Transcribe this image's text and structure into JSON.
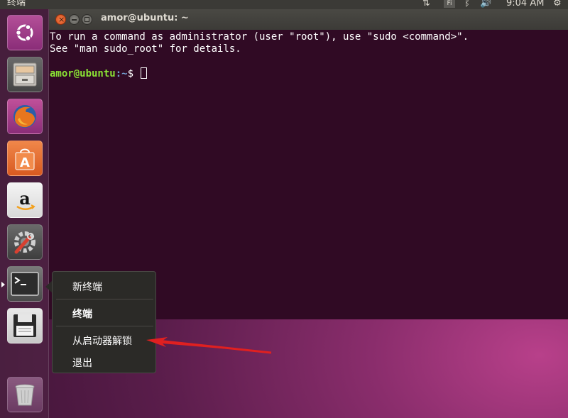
{
  "top_panel": {
    "app_title": "终端",
    "input_method": "Fi",
    "clock": "9:04 AM"
  },
  "terminal": {
    "title": "amor@ubuntu: ~",
    "output_line1": "To run a command as administrator (user \"root\"), use \"sudo <command>\".",
    "output_line2": "See \"man sudo_root\" for details.",
    "prompt_user": "amor@ubuntu",
    "prompt_path": ":~",
    "prompt_symbol": "$"
  },
  "launcher": {
    "items": [
      {
        "name": "ubuntu-dash-icon"
      },
      {
        "name": "files-icon"
      },
      {
        "name": "firefox-icon"
      },
      {
        "name": "software-center-icon"
      },
      {
        "name": "amazon-icon"
      },
      {
        "name": "system-settings-icon"
      },
      {
        "name": "terminal-icon"
      },
      {
        "name": "save-icon"
      },
      {
        "name": "trash-icon"
      }
    ]
  },
  "context_menu": {
    "new_terminal": "新终端",
    "app_name": "终端",
    "unlock_from_launcher": "从启动器解锁",
    "quit": "退出"
  },
  "colors": {
    "terminal_bg": "#300a24",
    "accent_orange": "#e95420",
    "annotation_red": "#e02020"
  }
}
